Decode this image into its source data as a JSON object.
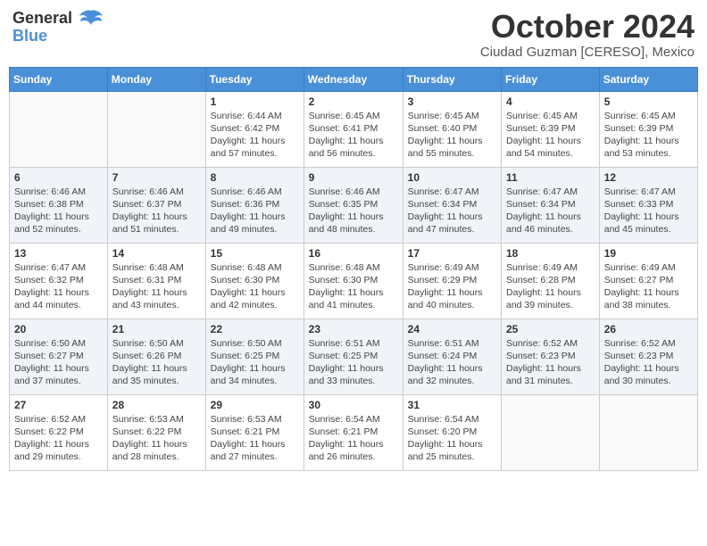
{
  "header": {
    "logo_line1": "General",
    "logo_line2": "Blue",
    "month": "October 2024",
    "location": "Ciudad Guzman [CERESO], Mexico"
  },
  "days_of_week": [
    "Sunday",
    "Monday",
    "Tuesday",
    "Wednesday",
    "Thursday",
    "Friday",
    "Saturday"
  ],
  "weeks": [
    [
      {
        "day": "",
        "info": ""
      },
      {
        "day": "",
        "info": ""
      },
      {
        "day": "1",
        "info": "Sunrise: 6:44 AM\nSunset: 6:42 PM\nDaylight: 11 hours and 57 minutes."
      },
      {
        "day": "2",
        "info": "Sunrise: 6:45 AM\nSunset: 6:41 PM\nDaylight: 11 hours and 56 minutes."
      },
      {
        "day": "3",
        "info": "Sunrise: 6:45 AM\nSunset: 6:40 PM\nDaylight: 11 hours and 55 minutes."
      },
      {
        "day": "4",
        "info": "Sunrise: 6:45 AM\nSunset: 6:39 PM\nDaylight: 11 hours and 54 minutes."
      },
      {
        "day": "5",
        "info": "Sunrise: 6:45 AM\nSunset: 6:39 PM\nDaylight: 11 hours and 53 minutes."
      }
    ],
    [
      {
        "day": "6",
        "info": "Sunrise: 6:46 AM\nSunset: 6:38 PM\nDaylight: 11 hours and 52 minutes."
      },
      {
        "day": "7",
        "info": "Sunrise: 6:46 AM\nSunset: 6:37 PM\nDaylight: 11 hours and 51 minutes."
      },
      {
        "day": "8",
        "info": "Sunrise: 6:46 AM\nSunset: 6:36 PM\nDaylight: 11 hours and 49 minutes."
      },
      {
        "day": "9",
        "info": "Sunrise: 6:46 AM\nSunset: 6:35 PM\nDaylight: 11 hours and 48 minutes."
      },
      {
        "day": "10",
        "info": "Sunrise: 6:47 AM\nSunset: 6:34 PM\nDaylight: 11 hours and 47 minutes."
      },
      {
        "day": "11",
        "info": "Sunrise: 6:47 AM\nSunset: 6:34 PM\nDaylight: 11 hours and 46 minutes."
      },
      {
        "day": "12",
        "info": "Sunrise: 6:47 AM\nSunset: 6:33 PM\nDaylight: 11 hours and 45 minutes."
      }
    ],
    [
      {
        "day": "13",
        "info": "Sunrise: 6:47 AM\nSunset: 6:32 PM\nDaylight: 11 hours and 44 minutes."
      },
      {
        "day": "14",
        "info": "Sunrise: 6:48 AM\nSunset: 6:31 PM\nDaylight: 11 hours and 43 minutes."
      },
      {
        "day": "15",
        "info": "Sunrise: 6:48 AM\nSunset: 6:30 PM\nDaylight: 11 hours and 42 minutes."
      },
      {
        "day": "16",
        "info": "Sunrise: 6:48 AM\nSunset: 6:30 PM\nDaylight: 11 hours and 41 minutes."
      },
      {
        "day": "17",
        "info": "Sunrise: 6:49 AM\nSunset: 6:29 PM\nDaylight: 11 hours and 40 minutes."
      },
      {
        "day": "18",
        "info": "Sunrise: 6:49 AM\nSunset: 6:28 PM\nDaylight: 11 hours and 39 minutes."
      },
      {
        "day": "19",
        "info": "Sunrise: 6:49 AM\nSunset: 6:27 PM\nDaylight: 11 hours and 38 minutes."
      }
    ],
    [
      {
        "day": "20",
        "info": "Sunrise: 6:50 AM\nSunset: 6:27 PM\nDaylight: 11 hours and 37 minutes."
      },
      {
        "day": "21",
        "info": "Sunrise: 6:50 AM\nSunset: 6:26 PM\nDaylight: 11 hours and 35 minutes."
      },
      {
        "day": "22",
        "info": "Sunrise: 6:50 AM\nSunset: 6:25 PM\nDaylight: 11 hours and 34 minutes."
      },
      {
        "day": "23",
        "info": "Sunrise: 6:51 AM\nSunset: 6:25 PM\nDaylight: 11 hours and 33 minutes."
      },
      {
        "day": "24",
        "info": "Sunrise: 6:51 AM\nSunset: 6:24 PM\nDaylight: 11 hours and 32 minutes."
      },
      {
        "day": "25",
        "info": "Sunrise: 6:52 AM\nSunset: 6:23 PM\nDaylight: 11 hours and 31 minutes."
      },
      {
        "day": "26",
        "info": "Sunrise: 6:52 AM\nSunset: 6:23 PM\nDaylight: 11 hours and 30 minutes."
      }
    ],
    [
      {
        "day": "27",
        "info": "Sunrise: 6:52 AM\nSunset: 6:22 PM\nDaylight: 11 hours and 29 minutes."
      },
      {
        "day": "28",
        "info": "Sunrise: 6:53 AM\nSunset: 6:22 PM\nDaylight: 11 hours and 28 minutes."
      },
      {
        "day": "29",
        "info": "Sunrise: 6:53 AM\nSunset: 6:21 PM\nDaylight: 11 hours and 27 minutes."
      },
      {
        "day": "30",
        "info": "Sunrise: 6:54 AM\nSunset: 6:21 PM\nDaylight: 11 hours and 26 minutes."
      },
      {
        "day": "31",
        "info": "Sunrise: 6:54 AM\nSunset: 6:20 PM\nDaylight: 11 hours and 25 minutes."
      },
      {
        "day": "",
        "info": ""
      },
      {
        "day": "",
        "info": ""
      }
    ]
  ]
}
